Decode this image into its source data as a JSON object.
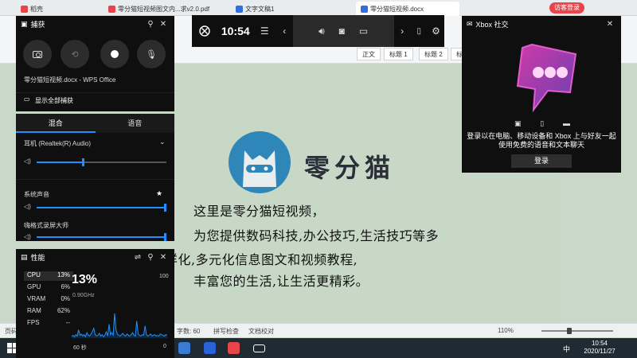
{
  "wps": {
    "tabs": [
      "稻壳",
      "零分猫短视频图文内...求v2.0.pdf",
      "文字文稿1",
      "零分猫短视频.docx"
    ],
    "login": "访客登录",
    "style_boxes": [
      "正文",
      "标题 1",
      "标题 2",
      "标"
    ],
    "doc_lines": [
      "这里是零分猫短视频，",
      "为您提供数码科技,办公技巧,生活技巧等多",
      "样化,多元化信息图文和视频教程,",
      "丰富您的生活,让生活更精彩。"
    ],
    "logo_text": "零分猫",
    "status": {
      "page": "页码",
      "words": "字数: 60",
      "spell": "拼写检查",
      "proof": "文档校对",
      "zoom": "110%"
    },
    "clock": {
      "time": "10:54",
      "date": "2020/11/27"
    },
    "ime": "中"
  },
  "xbox": {
    "topbar": {
      "time": "10:54"
    },
    "capture": {
      "title": "捕获",
      "current_app": "零分猫短视频.docx - WPS Office",
      "show_all": "显示全部捕获"
    },
    "audio": {
      "tabs": [
        "混合",
        "语音"
      ],
      "device": "耳机 (Realtek(R) Audio)",
      "device_level": 0.35,
      "system_label": "系统声音",
      "system_level": 1.0,
      "app_label": "嗨格式录屏大师",
      "app_level": 1.0
    },
    "performance": {
      "title": "性能",
      "metrics": [
        {
          "label": "CPU",
          "value": "13%"
        },
        {
          "label": "GPU",
          "value": "6%"
        },
        {
          "label": "VRAM",
          "value": "0%"
        },
        {
          "label": "RAM",
          "value": "62%"
        },
        {
          "label": "FPS",
          "value": "--"
        }
      ],
      "big_value": "13%",
      "freq": "0.90GHz",
      "max": "100",
      "x_left": "60 秒",
      "x_right": "0",
      "cpu_history": [
        3,
        4,
        2,
        5,
        3,
        12,
        4,
        6,
        3,
        5,
        2,
        8,
        4,
        3,
        6,
        10,
        14,
        5,
        3,
        4,
        7,
        3,
        5,
        2,
        4,
        9,
        3,
        20,
        5,
        8,
        4,
        36,
        12,
        6,
        4,
        3,
        5,
        7,
        4,
        3,
        6,
        4,
        3,
        5,
        8,
        4,
        3,
        25,
        6,
        4,
        3,
        5,
        4,
        18,
        5,
        3,
        4,
        6,
        3,
        4,
        5,
        3,
        4,
        3,
        6,
        5,
        4,
        3,
        5,
        4
      ]
    },
    "social": {
      "title": "Xbox 社交",
      "message": "登录以在电脑、移动设备和 Xbox 上与好友一起使用免费的语音和文本聊天",
      "login": "登录"
    }
  }
}
